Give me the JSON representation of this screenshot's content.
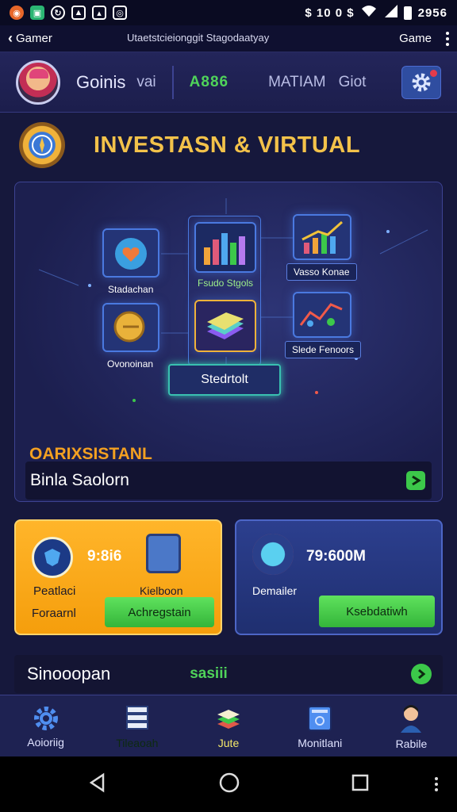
{
  "status_bar": {
    "right_text": "$ 10 0 $",
    "time": "2956"
  },
  "app_bar": {
    "back_label": "Gamer",
    "title": "Utaetstcieionggit Stagodaatyay",
    "right_label": "Game"
  },
  "profile": {
    "name": "Goinis",
    "sub": "vai",
    "green_value": "A886",
    "math_label": "MATIAM",
    "giot_label": "Giot"
  },
  "heading": {
    "title": "INVESTASN & VIRTUAL"
  },
  "panel": {
    "tiles": {
      "heart_label": "Stadachan",
      "coin_label": "Ovonoinan",
      "bars_label": "Fsudo Stgols",
      "books_label": "",
      "trend_label": "Vasso Konae",
      "graph_label": "Slede Fenoors"
    },
    "glow_button": "Stedrtolt",
    "orange_heading": "OARIXSISTANL",
    "search_text": "Binla Saolorn"
  },
  "card_a": {
    "value": "9:8i6",
    "label_1": "Peatlaci",
    "label_2": "Foraarnl",
    "cta": "Achregstain",
    "right_label": "Kielboon"
  },
  "card_b": {
    "value": "79:600M",
    "label": "Demailer",
    "cta": "Ksebdatiwh"
  },
  "banner": {
    "title": "Sinooopan",
    "green": "sasiii"
  },
  "bottom_nav": [
    {
      "label": "Aoioriig",
      "icon": "gear-icon"
    },
    {
      "label": "Tileaoah",
      "icon": "server-icon"
    },
    {
      "label": "Jute",
      "icon": "books-icon"
    },
    {
      "label": "Monitlani",
      "icon": "monitor-icon"
    },
    {
      "label": "Rabile",
      "icon": "person-icon"
    }
  ],
  "colors": {
    "accent_green": "#4fd35a",
    "accent_orange": "#f3a021",
    "accent_gold": "#f3c24a",
    "background": "#16183c"
  }
}
